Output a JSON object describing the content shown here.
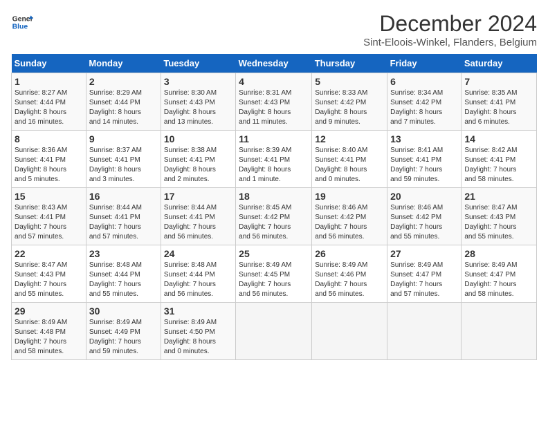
{
  "logo": {
    "line1": "General",
    "line2": "Blue"
  },
  "title": "December 2024",
  "subtitle": "Sint-Eloois-Winkel, Flanders, Belgium",
  "weekdays": [
    "Sunday",
    "Monday",
    "Tuesday",
    "Wednesday",
    "Thursday",
    "Friday",
    "Saturday"
  ],
  "weeks": [
    [
      {
        "day": "1",
        "info": "Sunrise: 8:27 AM\nSunset: 4:44 PM\nDaylight: 8 hours\nand 16 minutes."
      },
      {
        "day": "2",
        "info": "Sunrise: 8:29 AM\nSunset: 4:44 PM\nDaylight: 8 hours\nand 14 minutes."
      },
      {
        "day": "3",
        "info": "Sunrise: 8:30 AM\nSunset: 4:43 PM\nDaylight: 8 hours\nand 13 minutes."
      },
      {
        "day": "4",
        "info": "Sunrise: 8:31 AM\nSunset: 4:43 PM\nDaylight: 8 hours\nand 11 minutes."
      },
      {
        "day": "5",
        "info": "Sunrise: 8:33 AM\nSunset: 4:42 PM\nDaylight: 8 hours\nand 9 minutes."
      },
      {
        "day": "6",
        "info": "Sunrise: 8:34 AM\nSunset: 4:42 PM\nDaylight: 8 hours\nand 7 minutes."
      },
      {
        "day": "7",
        "info": "Sunrise: 8:35 AM\nSunset: 4:41 PM\nDaylight: 8 hours\nand 6 minutes."
      }
    ],
    [
      {
        "day": "8",
        "info": "Sunrise: 8:36 AM\nSunset: 4:41 PM\nDaylight: 8 hours\nand 5 minutes."
      },
      {
        "day": "9",
        "info": "Sunrise: 8:37 AM\nSunset: 4:41 PM\nDaylight: 8 hours\nand 3 minutes."
      },
      {
        "day": "10",
        "info": "Sunrise: 8:38 AM\nSunset: 4:41 PM\nDaylight: 8 hours\nand 2 minutes."
      },
      {
        "day": "11",
        "info": "Sunrise: 8:39 AM\nSunset: 4:41 PM\nDaylight: 8 hours\nand 1 minute."
      },
      {
        "day": "12",
        "info": "Sunrise: 8:40 AM\nSunset: 4:41 PM\nDaylight: 8 hours\nand 0 minutes."
      },
      {
        "day": "13",
        "info": "Sunrise: 8:41 AM\nSunset: 4:41 PM\nDaylight: 7 hours\nand 59 minutes."
      },
      {
        "day": "14",
        "info": "Sunrise: 8:42 AM\nSunset: 4:41 PM\nDaylight: 7 hours\nand 58 minutes."
      }
    ],
    [
      {
        "day": "15",
        "info": "Sunrise: 8:43 AM\nSunset: 4:41 PM\nDaylight: 7 hours\nand 57 minutes."
      },
      {
        "day": "16",
        "info": "Sunrise: 8:44 AM\nSunset: 4:41 PM\nDaylight: 7 hours\nand 57 minutes."
      },
      {
        "day": "17",
        "info": "Sunrise: 8:44 AM\nSunset: 4:41 PM\nDaylight: 7 hours\nand 56 minutes."
      },
      {
        "day": "18",
        "info": "Sunrise: 8:45 AM\nSunset: 4:42 PM\nDaylight: 7 hours\nand 56 minutes."
      },
      {
        "day": "19",
        "info": "Sunrise: 8:46 AM\nSunset: 4:42 PM\nDaylight: 7 hours\nand 56 minutes."
      },
      {
        "day": "20",
        "info": "Sunrise: 8:46 AM\nSunset: 4:42 PM\nDaylight: 7 hours\nand 55 minutes."
      },
      {
        "day": "21",
        "info": "Sunrise: 8:47 AM\nSunset: 4:43 PM\nDaylight: 7 hours\nand 55 minutes."
      }
    ],
    [
      {
        "day": "22",
        "info": "Sunrise: 8:47 AM\nSunset: 4:43 PM\nDaylight: 7 hours\nand 55 minutes."
      },
      {
        "day": "23",
        "info": "Sunrise: 8:48 AM\nSunset: 4:44 PM\nDaylight: 7 hours\nand 55 minutes."
      },
      {
        "day": "24",
        "info": "Sunrise: 8:48 AM\nSunset: 4:44 PM\nDaylight: 7 hours\nand 56 minutes."
      },
      {
        "day": "25",
        "info": "Sunrise: 8:49 AM\nSunset: 4:45 PM\nDaylight: 7 hours\nand 56 minutes."
      },
      {
        "day": "26",
        "info": "Sunrise: 8:49 AM\nSunset: 4:46 PM\nDaylight: 7 hours\nand 56 minutes."
      },
      {
        "day": "27",
        "info": "Sunrise: 8:49 AM\nSunset: 4:47 PM\nDaylight: 7 hours\nand 57 minutes."
      },
      {
        "day": "28",
        "info": "Sunrise: 8:49 AM\nSunset: 4:47 PM\nDaylight: 7 hours\nand 58 minutes."
      }
    ],
    [
      {
        "day": "29",
        "info": "Sunrise: 8:49 AM\nSunset: 4:48 PM\nDaylight: 7 hours\nand 58 minutes."
      },
      {
        "day": "30",
        "info": "Sunrise: 8:49 AM\nSunset: 4:49 PM\nDaylight: 7 hours\nand 59 minutes."
      },
      {
        "day": "31",
        "info": "Sunrise: 8:49 AM\nSunset: 4:50 PM\nDaylight: 8 hours\nand 0 minutes."
      },
      null,
      null,
      null,
      null
    ]
  ]
}
